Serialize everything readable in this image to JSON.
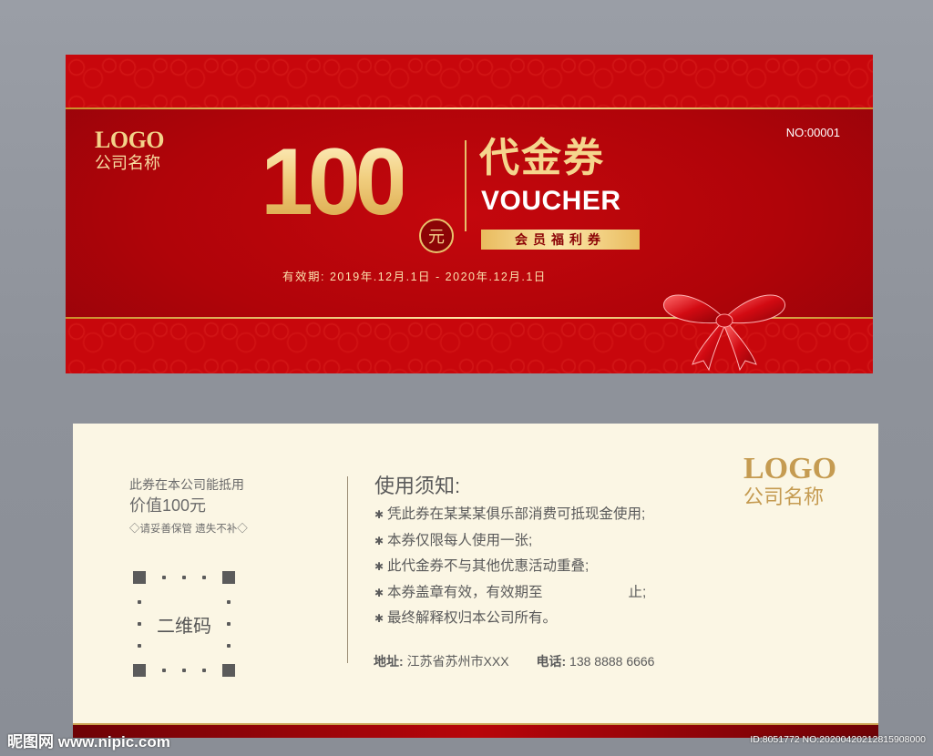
{
  "front": {
    "logo_text": "LOGO",
    "company_name": "公司名称",
    "serial_no": "NO:00001",
    "amount": "100",
    "currency": "元",
    "title_cn": "代金券",
    "title_en": "VOUCHER",
    "member_tag": "会员福利券",
    "validity": "有效期: 2019年.12月.1日 - 2020年.12月.1日"
  },
  "back": {
    "line1": "此券在本公司能抵用",
    "line2": "价值100元",
    "note": "◇请妥善保管 遗失不补◇",
    "qr_label": "二维码",
    "rules_title": "使用须知:",
    "rules": [
      "凭此券在某某某俱乐部消费可抵现金使用;",
      "本券仅限每人使用一张;",
      "此代金券不与其他优惠活动重叠;",
      "本券盖章有效，有效期至",
      "最终解释权归本公司所有。"
    ],
    "rule4_suffix": "止;",
    "address_label": "地址:",
    "address": "江苏省苏州市XXX",
    "phone_label": "电话:",
    "phone": "138 8888 6666",
    "logo_text": "LOGO",
    "company_name": "公司名称"
  },
  "watermark": {
    "left": "昵图网 www.nipic.com",
    "right": "ID:8051772 NO:20200420212815908000"
  },
  "colors": {
    "red": "#b00409",
    "gold": "#f2d48c",
    "cream": "#fbf6e4"
  }
}
